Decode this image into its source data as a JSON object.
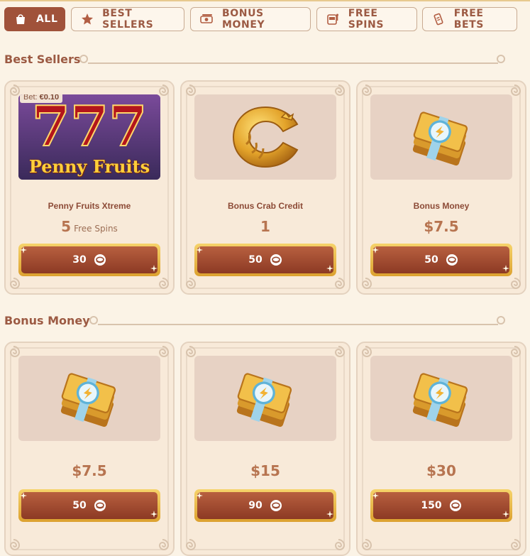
{
  "tabs": [
    {
      "label": "ALL",
      "icon": "bag-icon",
      "active": true
    },
    {
      "label": "BEST SELLERS",
      "icon": "star-icon",
      "active": false
    },
    {
      "label": "BONUS MONEY",
      "icon": "money-icon",
      "active": false
    },
    {
      "label": "FREE SPINS",
      "icon": "slot-machine-icon",
      "active": false
    },
    {
      "label": "FREE BETS",
      "icon": "ticket-icon",
      "active": false
    }
  ],
  "sections": [
    {
      "title": "Best Sellers",
      "cards": [
        {
          "badge_label": "Bet:",
          "badge_value": "€0.10",
          "image": "penny-fruits-xtreme-image",
          "image_text": "Penny Fruits",
          "name": "Penny Fruits Xtreme",
          "value": "5",
          "unit": "Free Spins",
          "price": "30"
        },
        {
          "image": "bonus-crab-credit-image",
          "name": "Bonus Crab Credit",
          "value": "1",
          "unit": "",
          "price": "50"
        },
        {
          "image": "bonus-money-image",
          "name": "Bonus Money",
          "value": "$7.5",
          "unit": "",
          "price": "50"
        }
      ]
    },
    {
      "title": "Bonus Money",
      "cards": [
        {
          "image": "bonus-money-image",
          "name": "",
          "value": "$7.5",
          "unit": "",
          "price": "50"
        },
        {
          "image": "bonus-money-image",
          "name": "",
          "value": "$15",
          "unit": "",
          "price": "90"
        },
        {
          "image": "bonus-money-image",
          "name": "",
          "value": "$30",
          "unit": "",
          "price": "150"
        }
      ]
    }
  ],
  "colors": {
    "accent": "#a0523a",
    "gold": "#e0a93a",
    "text": "#9c5a43"
  }
}
